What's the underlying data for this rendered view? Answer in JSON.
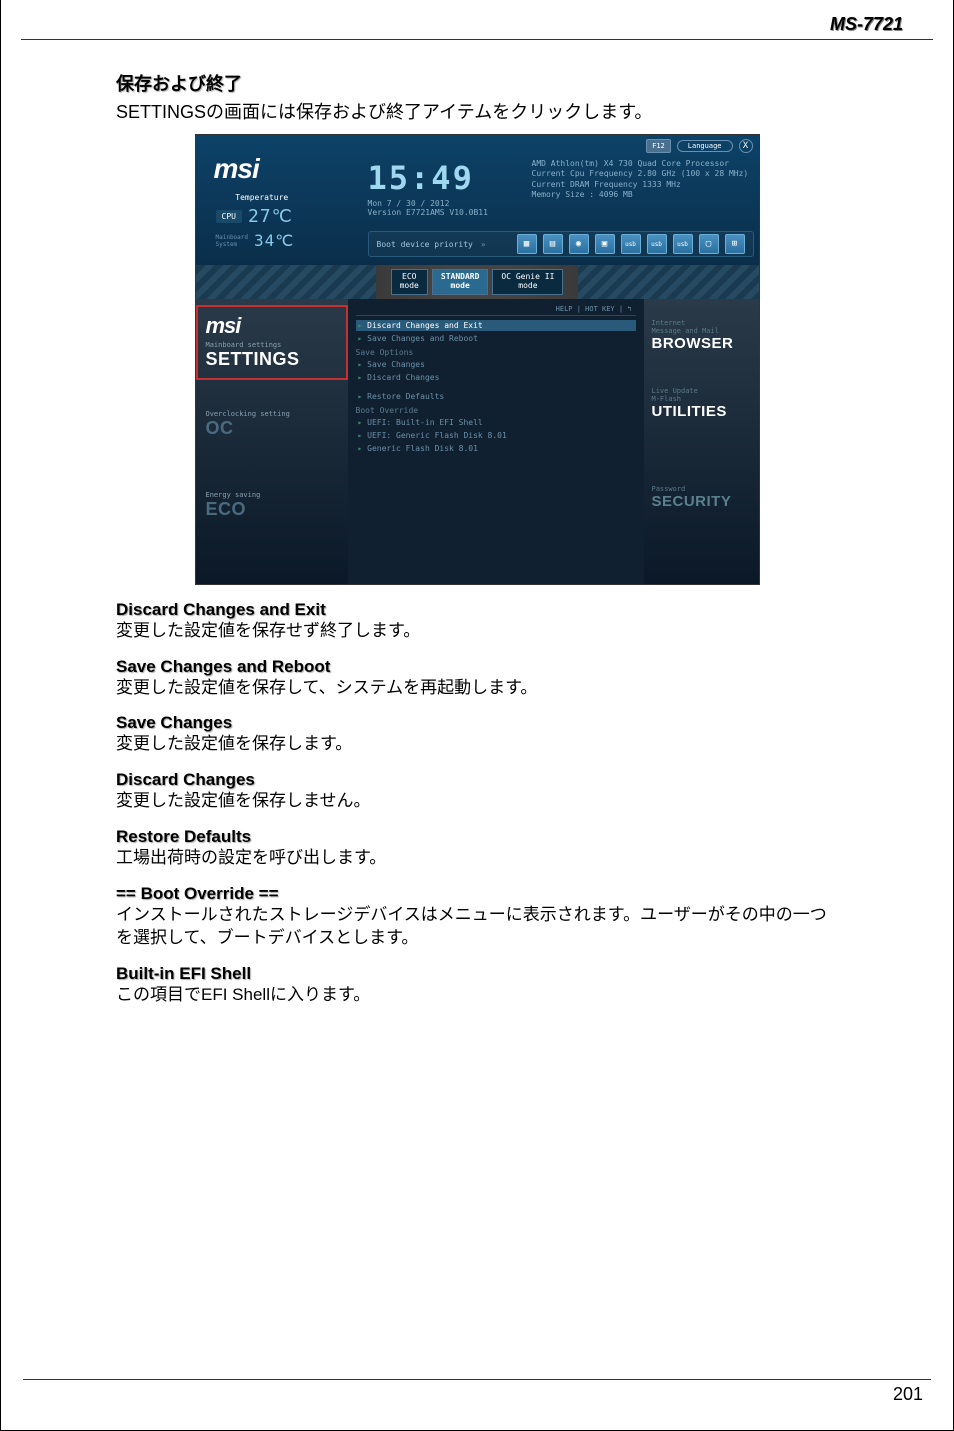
{
  "modelNumber": "MS-7721",
  "sectionTitle": "保存および終了",
  "sectionDesc": "SETTINGSの画面には保存および終了アイテムをクリックします。",
  "bios": {
    "header": {
      "f12": "F12",
      "language": "Language",
      "close": "X",
      "logo": "msi",
      "tempLabel": "Temperature",
      "cpuLabel": "CPU",
      "cpuTemp": "27℃",
      "sysLabel": "Mainboard\nSystem",
      "sysTemp": "34℃",
      "clock": "15:49",
      "date": "Mon  7 / 30 / 2012",
      "version": "Version E7721AMS V10.0B11",
      "info1": "AMD Athlon(tm) X4 730 Quad Core Processor",
      "info2": "Current Cpu Frequency 2.80 GHz (100 x 28 MHz)",
      "info3": "Current DRAM Frequency 1333 MHz",
      "info4": "Memory Size : 4096 MB",
      "bootPriority": "Boot device priority",
      "usb": "usb"
    },
    "modes": {
      "eco": "ECO\nmode",
      "standard": "STANDARD\nmode",
      "ocgenie": "OC Genie II\nmode"
    },
    "leftNav": {
      "settings": {
        "logo": "msi",
        "sub": "Mainboard settings",
        "big": "SETTINGS"
      },
      "oc": {
        "sub": "Overclocking setting",
        "big": "OC"
      },
      "eco": {
        "sub": "Energy saving",
        "big": "ECO"
      }
    },
    "center": {
      "helpbar": "HELP  |  HOT KEY  |  ↰",
      "items": [
        "Discard Changes and Exit",
        "Save Changes and Reboot"
      ],
      "saveHeader": "Save Options",
      "saveItems": [
        "Save Changes",
        "Discard Changes"
      ],
      "restore": "Restore Defaults",
      "bootHeader": "Boot Override",
      "bootItems": [
        "UEFI: Built-in EFI Shell",
        "UEFI: Generic Flash Disk 8.01",
        "Generic Flash Disk 8.01"
      ]
    },
    "rightNav": {
      "browser": {
        "sub": "Internet\nMessage and Mail",
        "big": "BROWSER"
      },
      "utilities": {
        "sub": "Live Update\nM-Flash",
        "big": "UTILITIES"
      },
      "security": {
        "sub": "Password",
        "big": "SECURITY"
      }
    }
  },
  "explain": [
    {
      "title": "Discard Changes and Exit",
      "body": "変更した設定値を保存せず終了します。"
    },
    {
      "title": "Save Changes and Reboot",
      "body": "変更した設定値を保存して、システムを再起動します。"
    },
    {
      "title": "Save Changes",
      "body": "変更した設定値を保存します。"
    },
    {
      "title": "Discard Changes",
      "body": "変更した設定値を保存しません。"
    },
    {
      "title": "Restore Defaults",
      "body": "工場出荷時の設定を呼び出します。"
    },
    {
      "title": "== Boot Override ==",
      "body": "インストールされたストレージデバイスはメニューに表示されます。ユーザーがその中の一つを選択して、ブートデバイスとします。"
    },
    {
      "title": "Built-in EFI Shell",
      "body": "この項目でEFI Shellに入ります。"
    }
  ],
  "pageNumber": "201"
}
